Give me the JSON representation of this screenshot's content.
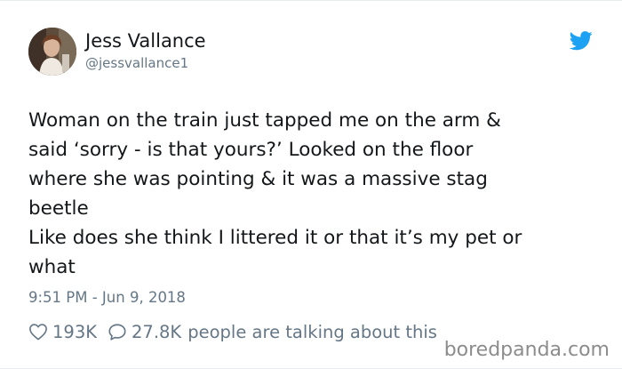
{
  "tweet": {
    "author_name": "Jess Vallance",
    "author_handle": "@jessvallance1",
    "text_lines": [
      "Woman on the train just tapped me on the arm &",
      "said ‘sorry - is that yours?’ Looked on the floor",
      "where she was pointing & it was a massive stag",
      "beetle",
      "Like does she think I littered it or that it’s my pet or",
      "what"
    ],
    "timestamp": "9:51 PM - Jun 9, 2018",
    "likes": "193K",
    "replies": "27.8K",
    "talking_label": "people are talking about this"
  },
  "watermark": "boredpanda.com",
  "colors": {
    "text": "#14171a",
    "muted": "#657786",
    "twitter_blue": "#1da1f2",
    "watermark": "#8c8c8c"
  },
  "icons": {
    "brand": "twitter-bird-icon",
    "like": "heart-icon",
    "reply": "speech-bubble-icon"
  }
}
